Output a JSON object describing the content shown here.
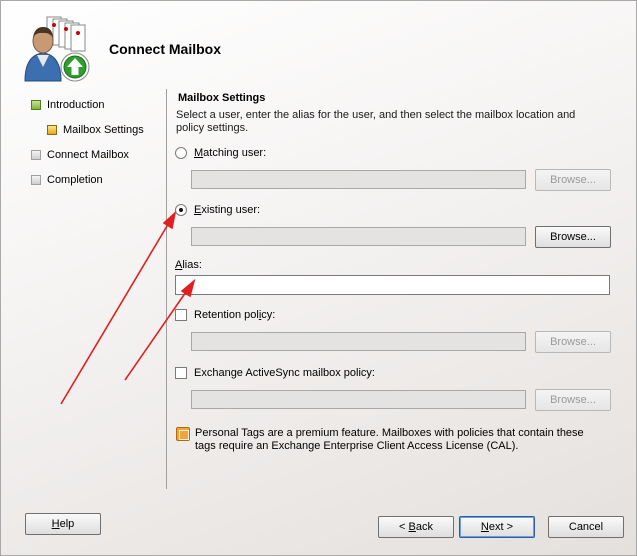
{
  "wizard": {
    "title": "Connect Mailbox"
  },
  "nav": {
    "items": [
      {
        "label": "Introduction",
        "state": "done"
      },
      {
        "label": "Mailbox Settings",
        "state": "current"
      },
      {
        "label": "Connect Mailbox",
        "state": "pending"
      },
      {
        "label": "Completion",
        "state": "pending"
      }
    ]
  },
  "section": {
    "title": "Mailbox Settings",
    "description": "Select a user, enter the alias for the user, and then select the mailbox location and policy settings."
  },
  "form": {
    "matching_user": {
      "label_mnemonic": "M",
      "label_rest": "atching user:",
      "selected": false,
      "value": "",
      "browse_label": "Browse...",
      "browse_enabled": false
    },
    "existing_user": {
      "label_mnemonic": "E",
      "label_rest": "xisting user:",
      "selected": true,
      "value": "",
      "browse_label": "Browse...",
      "browse_enabled": true
    },
    "alias": {
      "label_mnemonic": "A",
      "label_rest": "lias:",
      "value": ""
    },
    "retention_policy": {
      "label_pre": "Retention pol",
      "label_mnemonic": "i",
      "label_rest": "cy:",
      "checked": false,
      "value": "",
      "browse_label": "Browse...",
      "browse_enabled": false
    },
    "activesync_policy": {
      "label": "Exchange ActiveSync mailbox policy:",
      "checked": false,
      "value": "",
      "browse_label": "Browse...",
      "browse_enabled": false
    }
  },
  "info": {
    "icon": "personal-tags-icon",
    "text": "Personal Tags are a premium feature. Mailboxes with policies that contain these tags require an Exchange Enterprise Client Access License (CAL)."
  },
  "buttons": {
    "help": {
      "mnemonic": "H",
      "rest": "elp"
    },
    "back": {
      "arrow": "<",
      "mnemonic": "B",
      "rest": "ack"
    },
    "next": {
      "mnemonic": "N",
      "rest": "ext",
      "arrow": ">"
    },
    "cancel": "Cancel"
  },
  "colors": {
    "annotation_arrow": "#e02020",
    "accent_green": "#2e9e2e"
  }
}
